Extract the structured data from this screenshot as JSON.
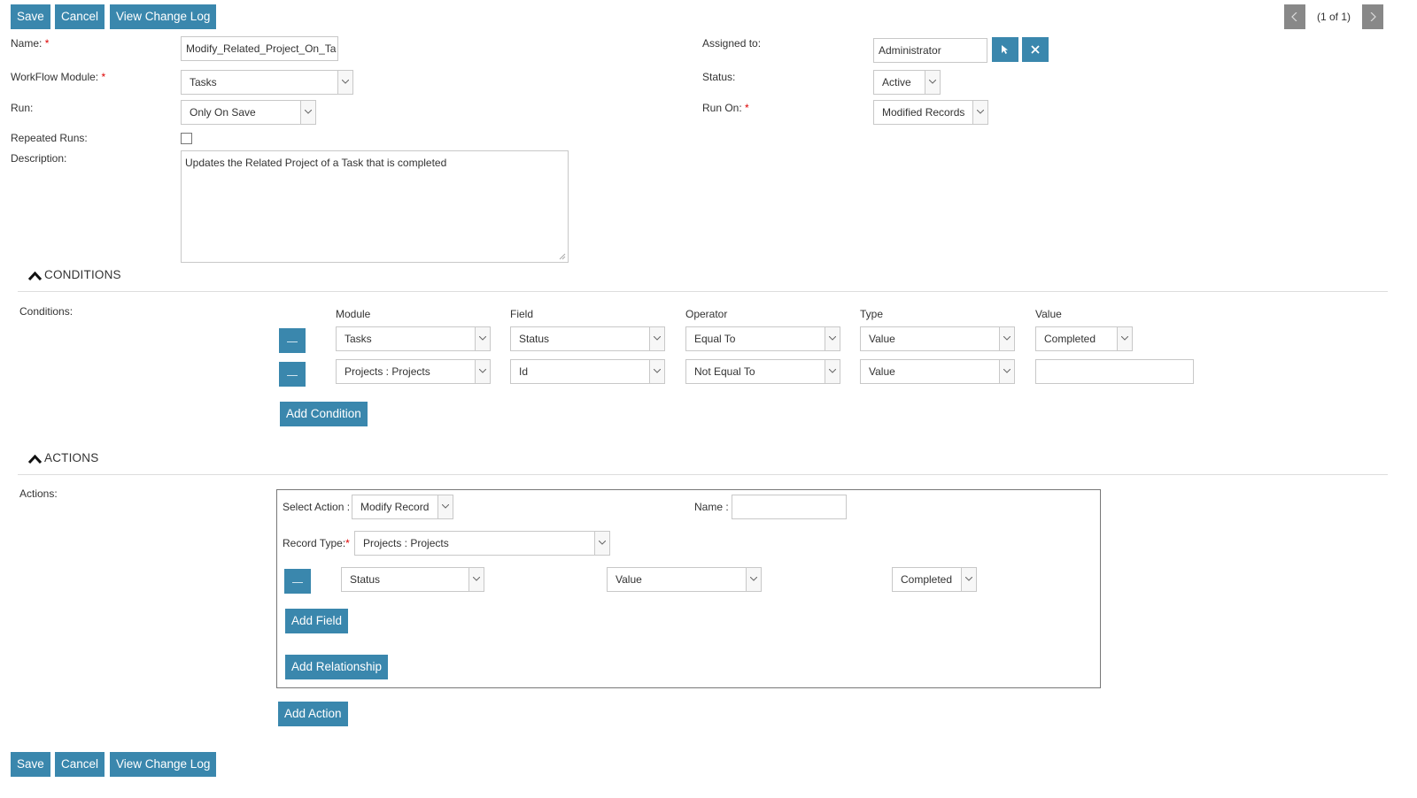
{
  "toolbar": {
    "save": "Save",
    "cancel": "Cancel",
    "change_log": "View Change Log"
  },
  "pagination": {
    "text": "(1 of 1)"
  },
  "form": {
    "name_label": "Name:",
    "name_value": "Modify_Related_Project_On_Ta",
    "workflow_module_label": "WorkFlow Module:",
    "workflow_module_value": "Tasks",
    "run_label": "Run:",
    "run_value": "Only On Save",
    "repeated_runs_label": "Repeated Runs:",
    "description_label": "Description:",
    "description_value": "Updates the Related Project of a Task that is completed",
    "assigned_to_label": "Assigned to:",
    "assigned_to_value": "Administrator",
    "status_label": "Status:",
    "status_value": "Active",
    "run_on_label": "Run On:",
    "run_on_value": "Modified Records",
    "required_mark": "*"
  },
  "conditions": {
    "section_title": "CONDITIONS",
    "label": "Conditions:",
    "headers": {
      "module": "Module",
      "field": "Field",
      "operator": "Operator",
      "type": "Type",
      "value": "Value"
    },
    "rows": [
      {
        "module": "Tasks",
        "field": "Status",
        "operator": "Equal To",
        "type": "Value",
        "value": "Completed"
      },
      {
        "module": "Projects : Projects",
        "field": "Id",
        "operator": "Not Equal To",
        "type": "Value",
        "value": ""
      }
    ],
    "add_button": "Add Condition"
  },
  "actions": {
    "section_title": "ACTIONS",
    "label": "Actions:",
    "select_action_label": "Select Action :",
    "select_action_value": "Modify Record",
    "name_label": "Name :",
    "name_value": "",
    "record_type_label": "Record Type:",
    "record_type_value": "Projects : Projects",
    "field_row": {
      "field": "Status",
      "type": "Value",
      "value": "Completed"
    },
    "add_field": "Add Field",
    "add_relationship": "Add Relationship",
    "add_action": "Add Action"
  },
  "colors": {
    "button": "#3a87ad",
    "required": "#dd0000",
    "pager": "#888888"
  }
}
